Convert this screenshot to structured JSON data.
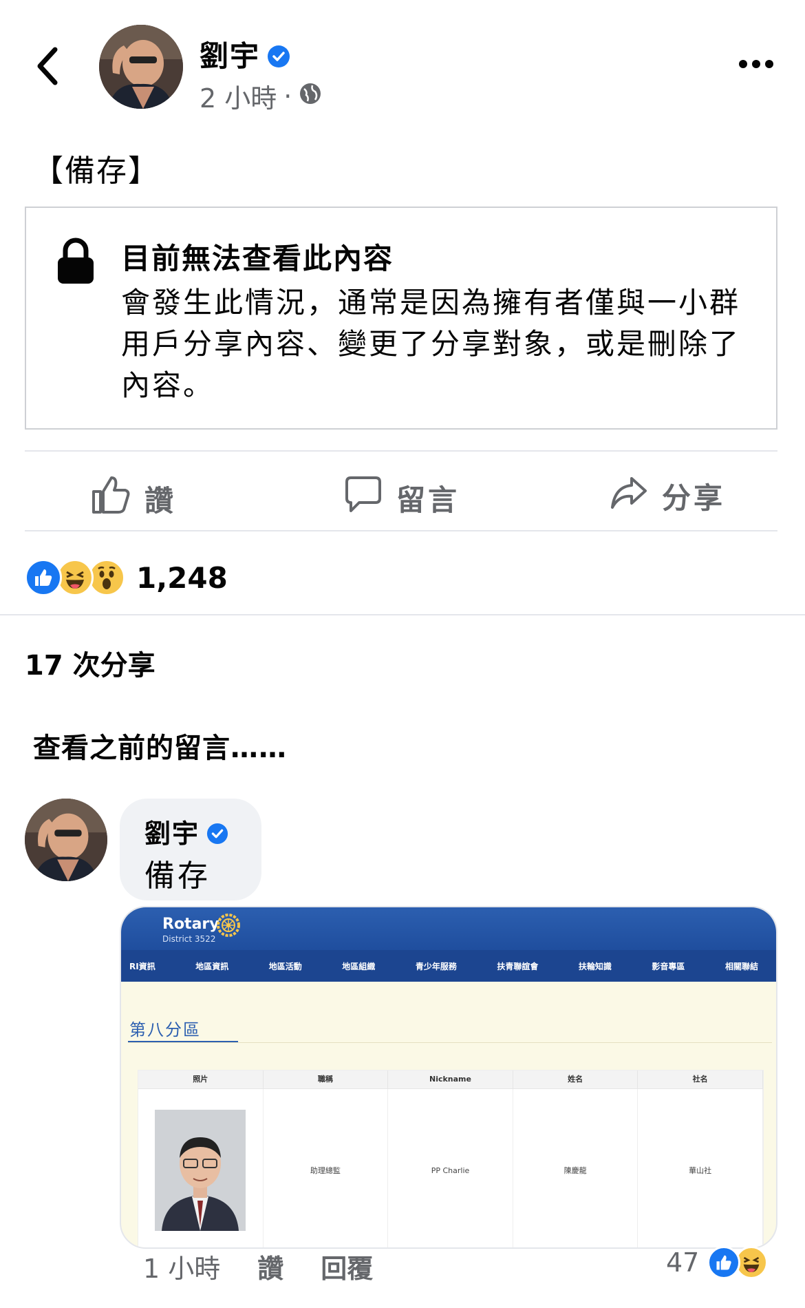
{
  "header": {
    "author": "劉宇",
    "time": "2 小時",
    "separator": "·"
  },
  "post": {
    "text": "【備存】",
    "unavailable_title": "目前無法查看此內容",
    "unavailable_body": "會發生此情況，通常是因為擁有者僅與一小群用戶分享內容、變更了分享對象，或是刪除了內容。"
  },
  "actions": {
    "like": "讚",
    "comment": "留言",
    "share": "分享"
  },
  "reactions": {
    "count": "1,248",
    "icons": [
      "like-icon",
      "haha-icon",
      "wow-icon"
    ]
  },
  "shares": "17 次分享",
  "previous_comments": "查看之前的留言……",
  "comment": {
    "author": "劉宇",
    "text": "備存",
    "time": "1 小時",
    "like": "讚",
    "reply": "回覆",
    "reaction_count": "47"
  },
  "attachment": {
    "logo_name": "Rotary",
    "logo_sub": "District 3522",
    "nav": [
      "RI資訊",
      "地區資訊",
      "地區活動",
      "地區組織",
      "青少年服務",
      "扶青聯誼會",
      "扶輪知識",
      "影音專區",
      "相關聯結"
    ],
    "region": "第八分區",
    "table_headers": [
      "照片",
      "職稱",
      "Nickname",
      "姓名",
      "社名"
    ],
    "table_row": [
      "",
      "助理總監",
      "PP Charlie",
      "陳慶龍",
      "華山社"
    ]
  },
  "colors": {
    "accent": "#1877f2",
    "muted": "#65676b",
    "divider": "#e4e6eb"
  }
}
